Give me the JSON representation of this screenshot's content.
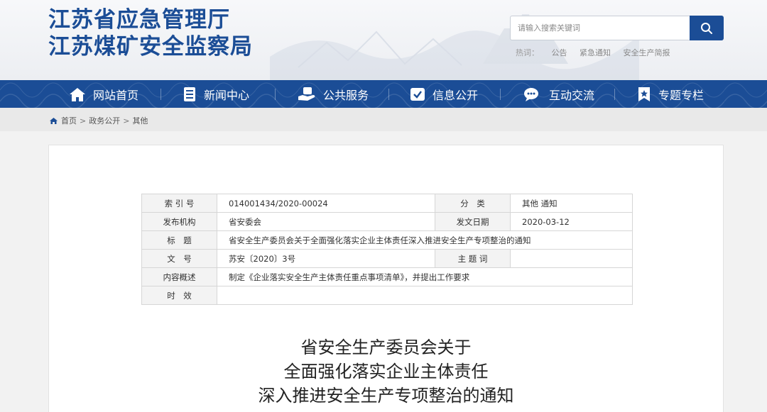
{
  "site": {
    "title_line1": "江苏省应急管理厅",
    "title_line2": "江苏煤矿安全监察局"
  },
  "search": {
    "placeholder": "请输入搜索关键词",
    "button_icon": "search-icon",
    "hot_label": "热词：",
    "hot_words": [
      "公告",
      "紧急通知",
      "安全生产简报"
    ]
  },
  "nav": {
    "items": [
      {
        "label": "网站首页",
        "icon": "home-icon"
      },
      {
        "label": "新闻中心",
        "icon": "document-icon"
      },
      {
        "label": "公共服务",
        "icon": "service-hand-icon"
      },
      {
        "label": "信息公开",
        "icon": "info-check-icon"
      },
      {
        "label": "互动交流",
        "icon": "chat-icon"
      },
      {
        "label": "专题专栏",
        "icon": "bookmark-icon"
      }
    ]
  },
  "breadcrumb": {
    "icon": "home-icon",
    "items": [
      "首页",
      "政务公开",
      "其他"
    ],
    "separator": ">"
  },
  "info_table": {
    "index_label": "索 引 号",
    "index_value": "014001434/2020-00024",
    "category_label": "分　类",
    "category_value": "其他 通知",
    "publisher_label": "发布机构",
    "publisher_value": "省安委会",
    "date_label": "发文日期",
    "date_value": "2020-03-12",
    "title_label": "标　题",
    "title_value": "省安全生产委员会关于全面强化落实企业主体责任深入推进安全生产专项整治的通知",
    "docno_label": "文　号",
    "docno_value": "苏安〔2020〕3号",
    "keywords_label": "主 题 词",
    "keywords_value": "",
    "summary_label": "内容概述",
    "summary_value": "制定《企业落实安全生产主体责任重点事项清单》，并提出工作要求",
    "validity_label": "时　效",
    "validity_value": ""
  },
  "document": {
    "title_lines": [
      "省安全生产委员会关于",
      "全面强化落实企业主体责任",
      "深入推进安全生产专项整治的通知"
    ]
  },
  "colors": {
    "brand_blue": "#1b4d96",
    "nav_text": "#ffffff",
    "label_bg": "#f3f3f3",
    "border": "#d6d6d6"
  }
}
